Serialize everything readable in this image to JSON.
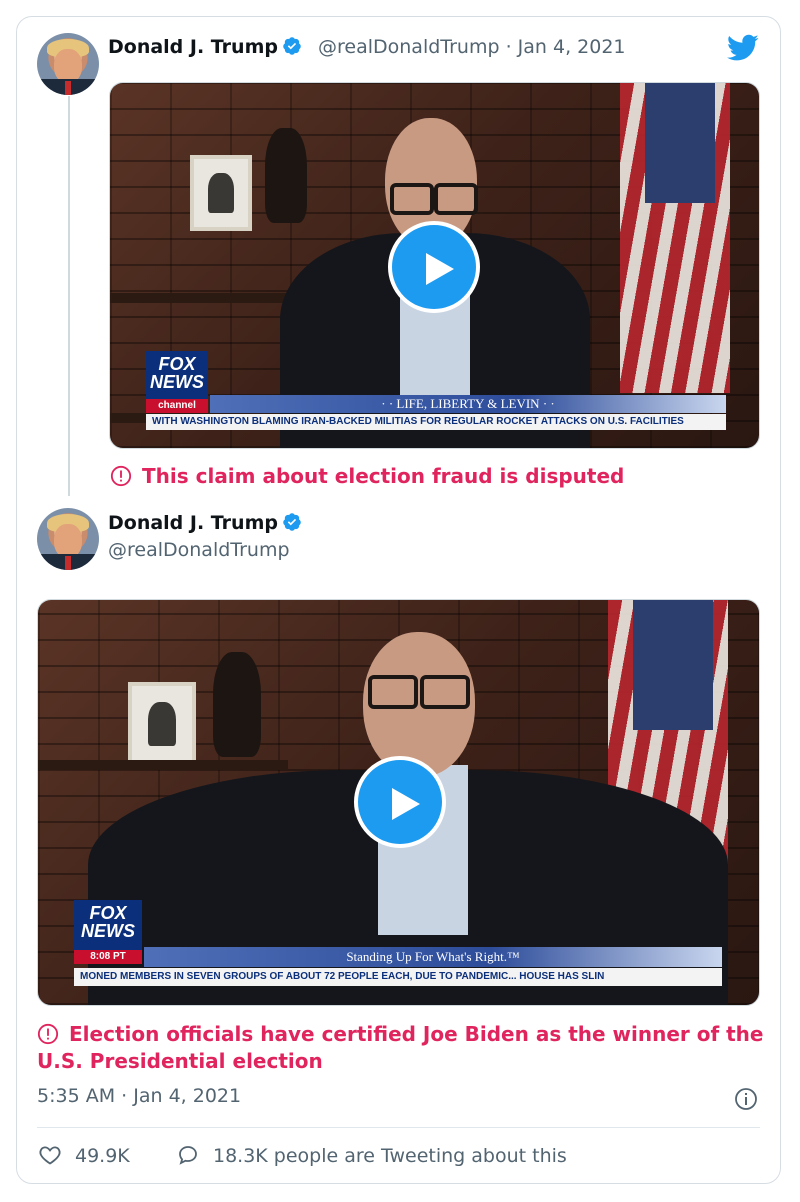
{
  "tweet1": {
    "author_name": "Donald J. Trump",
    "handle": "@realDonaldTrump",
    "separator": "·",
    "date": "Jan 4, 2021",
    "media": {
      "channel_top": "FOX",
      "channel_mid": "NEWS",
      "channel_bottom": "channel",
      "show_title": "· · LIFE, LIBERTY & LEVIN · ·",
      "ticker": "WITH WASHINGTON BLAMING IRAN-BACKED MILITIAS FOR REGULAR ROCKET ATTACKS ON U.S. FACILITIES"
    },
    "notice": "This claim about election fraud is disputed"
  },
  "tweet2": {
    "author_name": "Donald J. Trump",
    "handle": "@realDonaldTrump",
    "media": {
      "channel_top": "FOX",
      "channel_mid": "NEWS",
      "channel_bottom": "8:08 PT",
      "show_title": "Standing Up For What's Right.™",
      "ticker": "MONED MEMBERS IN SEVEN GROUPS OF ABOUT 72 PEOPLE EACH, DUE TO PANDEMIC...   HOUSE HAS SLIN"
    },
    "notice": "Election officials have certified Joe Biden as the winner of the U.S. Presidential election",
    "time": "5:35 AM",
    "separator": "·",
    "date": "Jan 4, 2021",
    "likes": "49.9K",
    "conversation": "18.3K people are Tweeting about this"
  },
  "icons": {
    "brand": "twitter-bird-icon",
    "verified": "verified-badge-icon",
    "play": "play-icon",
    "warning": "exclamation-circle-icon",
    "info": "info-icon",
    "like": "heart-icon",
    "reply": "speech-bubble-icon"
  },
  "colors": {
    "brand_blue": "#1d9bf0",
    "notice_red": "#e0245e",
    "secondary_text": "#536471"
  }
}
